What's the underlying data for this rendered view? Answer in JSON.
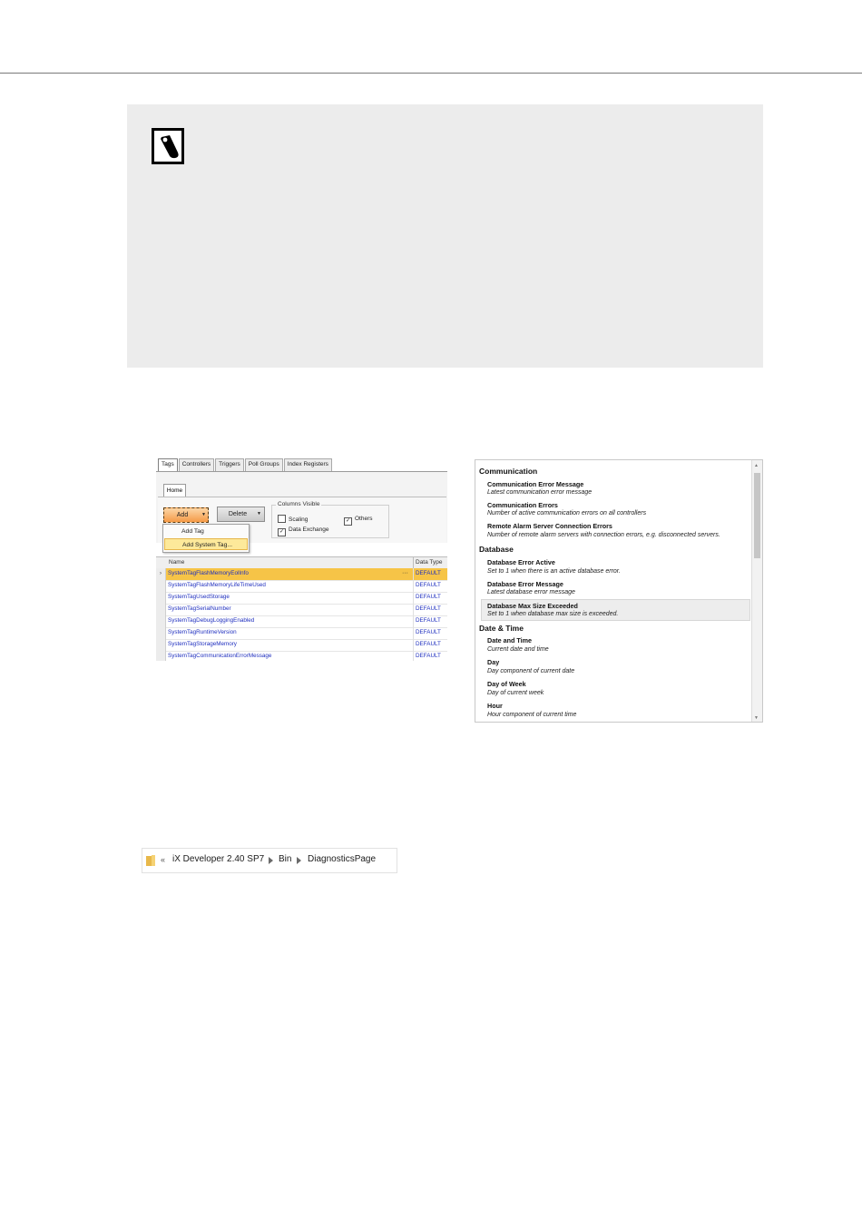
{
  "tag_editor": {
    "tabs": [
      "Tags",
      "Controllers",
      "Triggers",
      "Poll Groups",
      "Index Registers"
    ],
    "ribbon_tab": "Home",
    "add_button": "Add",
    "delete_button": "Delete",
    "columns_visible": {
      "title": "Columns Visible",
      "scaling": "Scaling",
      "others": "Others",
      "data_exchange": "Data Exchange"
    },
    "add_menu": [
      "Add Tag",
      "Add System Tag..."
    ],
    "grid": {
      "headers": [
        "Name",
        "Data Type"
      ],
      "rows": [
        {
          "name": "SystemTagFlashMemoryEolInfo",
          "type": "DEFAULT"
        },
        {
          "name": "SystemTagFlashMemoryLifeTimeUsed",
          "type": "DEFAULT"
        },
        {
          "name": "SystemTagUsedStorage",
          "type": "DEFAULT"
        },
        {
          "name": "SystemTagSerialNumber",
          "type": "DEFAULT"
        },
        {
          "name": "SystemTagDebugLoggingEnabled",
          "type": "DEFAULT"
        },
        {
          "name": "SystemTagRuntimeVersion",
          "type": "DEFAULT"
        },
        {
          "name": "SystemTagStorageMemory",
          "type": "DEFAULT"
        },
        {
          "name": "SystemTagCommunicationErrorMessage",
          "type": "DEFAULT"
        }
      ]
    }
  },
  "system_tags": {
    "categories": [
      {
        "name": "Communication",
        "items": [
          {
            "name": "Communication Error Message",
            "desc": "Latest communication error message"
          },
          {
            "name": "Communication Errors",
            "desc": "Number of active communication errors on all controllers"
          },
          {
            "name": "Remote Alarm Server Connection Errors",
            "desc": "Number of remote alarm servers with connection errors, e.g. disconnected servers."
          }
        ]
      },
      {
        "name": "Database",
        "items": [
          {
            "name": "Database Error Active",
            "desc": "Set to 1 when there is an active database error."
          },
          {
            "name": "Database Error Message",
            "desc": "Latest database error message"
          },
          {
            "name": "Database Max Size Exceeded",
            "desc": "Set to 1 when database max size is exceeded."
          }
        ]
      },
      {
        "name": "Date & Time",
        "items": [
          {
            "name": "Date and Time",
            "desc": "Current date and time"
          },
          {
            "name": "Day",
            "desc": "Day component of current date"
          },
          {
            "name": "Day of Week",
            "desc": "Day of current week"
          },
          {
            "name": "Hour",
            "desc": "Hour component of current time"
          }
        ]
      }
    ]
  },
  "breadcrumb": {
    "overflow": "«",
    "parts": [
      "iX Developer 2.40 SP7",
      "Bin",
      "DiagnosticsPage"
    ]
  }
}
